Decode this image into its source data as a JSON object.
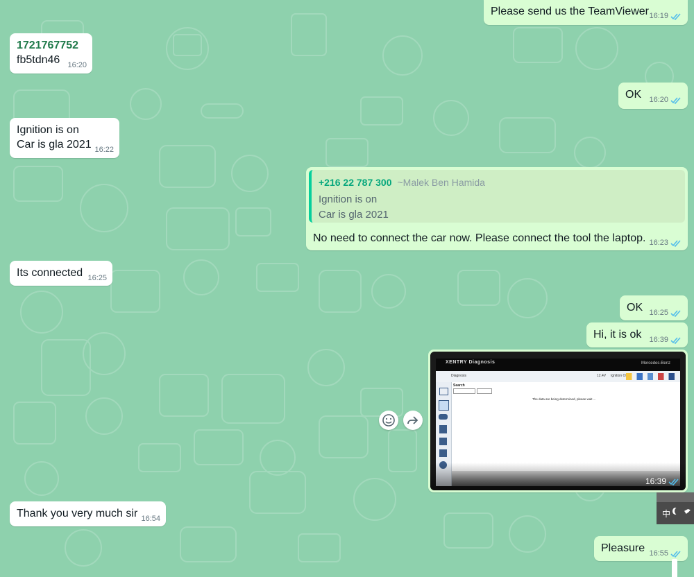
{
  "colors": {
    "wallpaper": "#8ed1ad",
    "incoming": "#ffffff",
    "outgoing": "#d9fdd3",
    "read_ticks": "#53bdeb"
  },
  "messages": [
    {
      "dir": "out",
      "text": "Please send us the TeamViewer",
      "time": "16:19"
    },
    {
      "dir": "in",
      "line1": "1721767752",
      "line2": "fb5tdn46",
      "time": "16:20"
    },
    {
      "dir": "out",
      "text": "OK",
      "time": "16:20"
    },
    {
      "dir": "in",
      "line1": "Ignition is on",
      "line2": "Car is gla 2021",
      "time": "16:22"
    },
    {
      "dir": "out",
      "quote": {
        "number": "+216 22 787 300",
        "alias": "~Malek Ben Hamida",
        "line1": "Ignition is on",
        "line2": "Car is gla 2021"
      },
      "text": "No need to connect the car now. Please connect the tool the laptop.",
      "time": "16:23"
    },
    {
      "dir": "in",
      "text": "Its connected",
      "time": "16:25"
    },
    {
      "dir": "out",
      "text": "OK",
      "time": "16:25"
    },
    {
      "dir": "out",
      "text": "Hi, it is ok",
      "time": "16:39"
    },
    {
      "dir": "out",
      "type": "image",
      "time": "16:39",
      "screen": {
        "app_title": "XENTRY Diagnosis",
        "brand": "Mercedes-Benz",
        "crumb": "Diagnosis",
        "search_label": "Search",
        "status": "The data are being determined, please wait ...",
        "voltage": "12.4V",
        "ignition": "Ignition ON"
      }
    },
    {
      "dir": "in",
      "text": "Thank you very much sir",
      "time": "16:54"
    },
    {
      "dir": "out",
      "text": "Pleasure",
      "time": "16:55"
    }
  ],
  "taskbar": {
    "ime": "中"
  }
}
